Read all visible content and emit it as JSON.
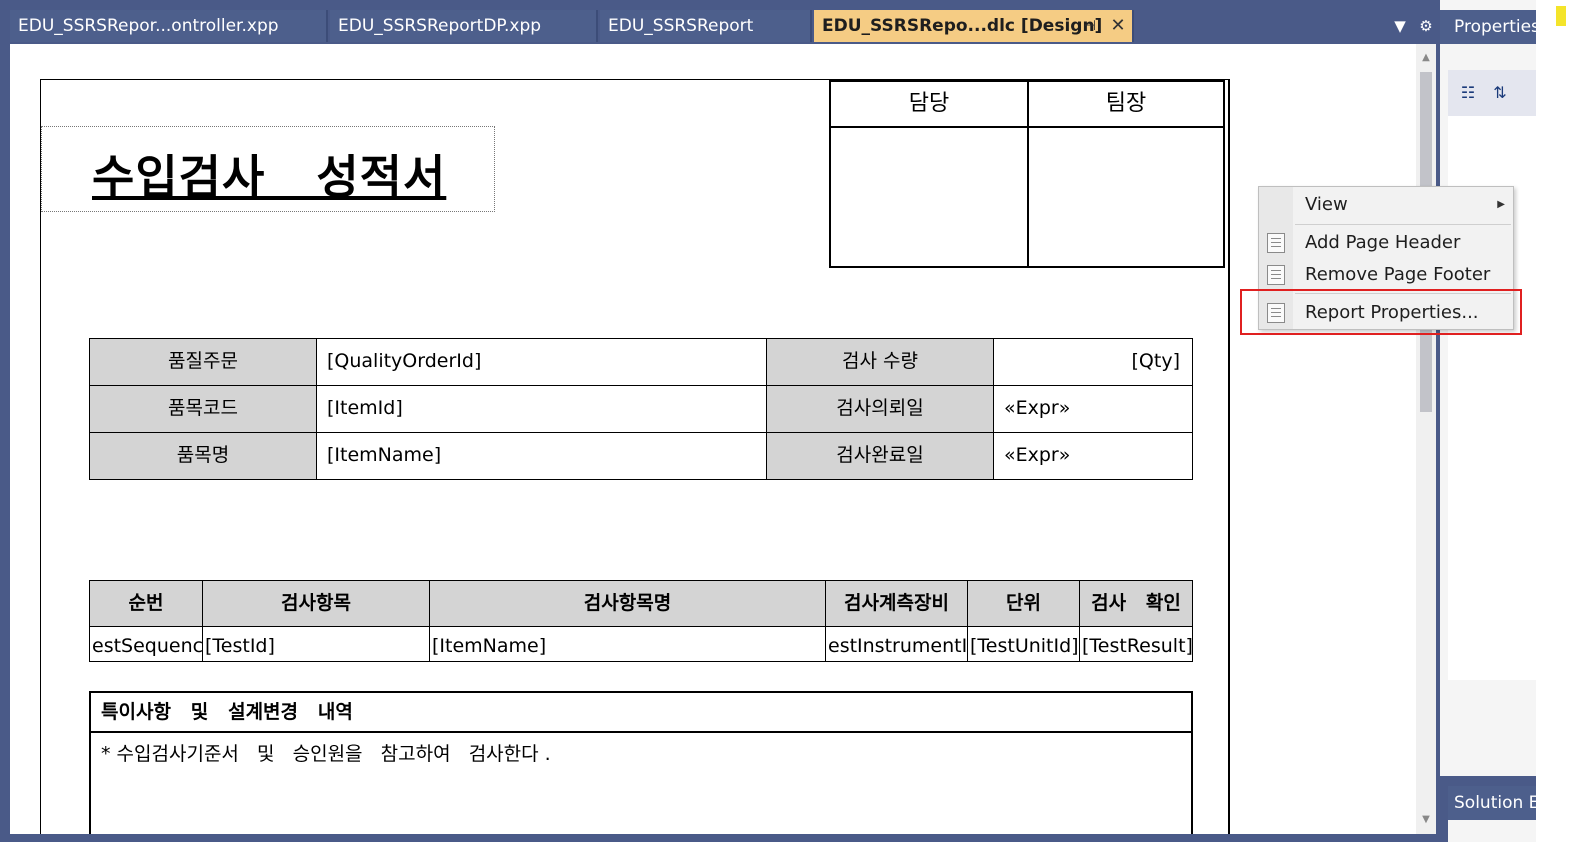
{
  "tabs": [
    {
      "label": "EDU_SSRSRepor...ontroller.xpp",
      "active": false
    },
    {
      "label": "EDU_SSRSReportDP.xpp",
      "active": false
    },
    {
      "label": "EDU_SSRSReport",
      "active": false
    },
    {
      "label": "EDU_SSRSRepo...dlc [Design]",
      "active": true
    }
  ],
  "tab_icons": {
    "pin": "pin-icon",
    "close": "close-icon",
    "dropdown": "dropdown-icon",
    "settings": "gear-icon"
  },
  "report": {
    "title": "수입검사   성적서",
    "approval": {
      "col1": "담당",
      "col2": "팀장"
    },
    "info": {
      "row1_label": "품질주문",
      "row1_value": "[QualityOrderId]",
      "row1_label2": "검사   수량",
      "row1_value2": "[Qty]",
      "row2_label": "품목코드",
      "row2_value": "[ItemId]",
      "row2_label2": "검사의뢰일",
      "row2_value2": "«Expr»",
      "row3_label": "품목명",
      "row3_value": "[ItemName]",
      "row3_label2": "검사완료일",
      "row3_value2": "«Expr»"
    },
    "grid": {
      "headers": [
        "순번",
        "검사항목",
        "검사항목명",
        "검사계측장비",
        "단위",
        "검사   확인"
      ],
      "cells": [
        "estSequenc",
        "[TestId]",
        "[ItemName]",
        "estInstrumentI",
        "[TestUnitId]",
        "[TestResult]"
      ]
    },
    "remarks": {
      "title": "특이사항   및   설계변경   내역",
      "body": "* 수입검사기준서   및   승인원을   참고하여   검사한다 ."
    }
  },
  "context_menu": {
    "items": [
      {
        "label": "View",
        "has_submenu": true
      },
      {
        "label": "Add Page Header",
        "icon": "page-header-icon"
      },
      {
        "label": "Remove Page Footer",
        "icon": "page-footer-icon"
      },
      {
        "label": "Report Properties...",
        "icon": "report-properties-icon",
        "highlighted": true
      }
    ],
    "highlight_color": "#e02020"
  },
  "panels": {
    "properties_title": "Properties",
    "solution_title": "Solution E"
  },
  "colors": {
    "chrome": "#4a5a88",
    "active_tab": "#f5cc84",
    "label_fill": "#d4d4d4"
  }
}
